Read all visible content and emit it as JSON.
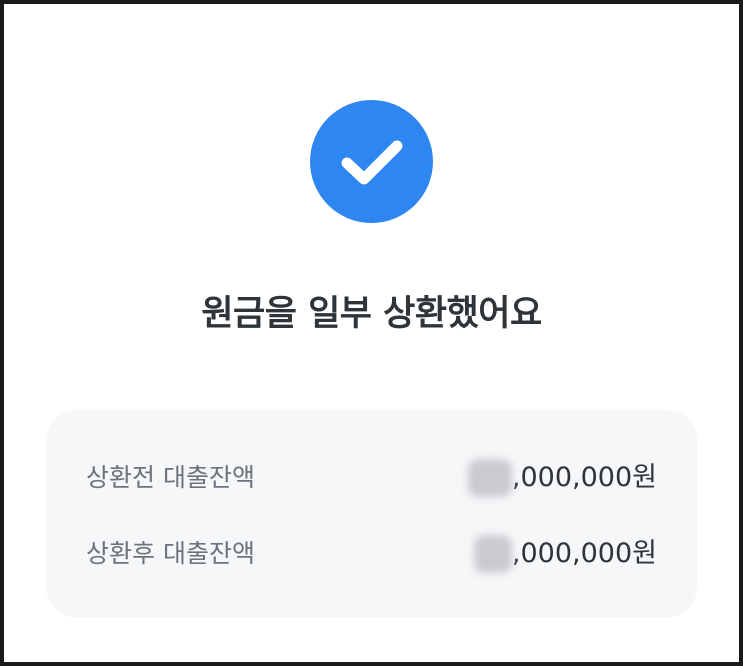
{
  "status": {
    "icon": "check-icon",
    "color": "#2e86f0",
    "title": "원금을 일부 상환했어요"
  },
  "summary": {
    "rows": [
      {
        "label": "상환전 대출잔액",
        "amount_visible": ",000,000원"
      },
      {
        "label": "상환후 대출잔액",
        "amount_visible": ",000,000원"
      }
    ]
  }
}
